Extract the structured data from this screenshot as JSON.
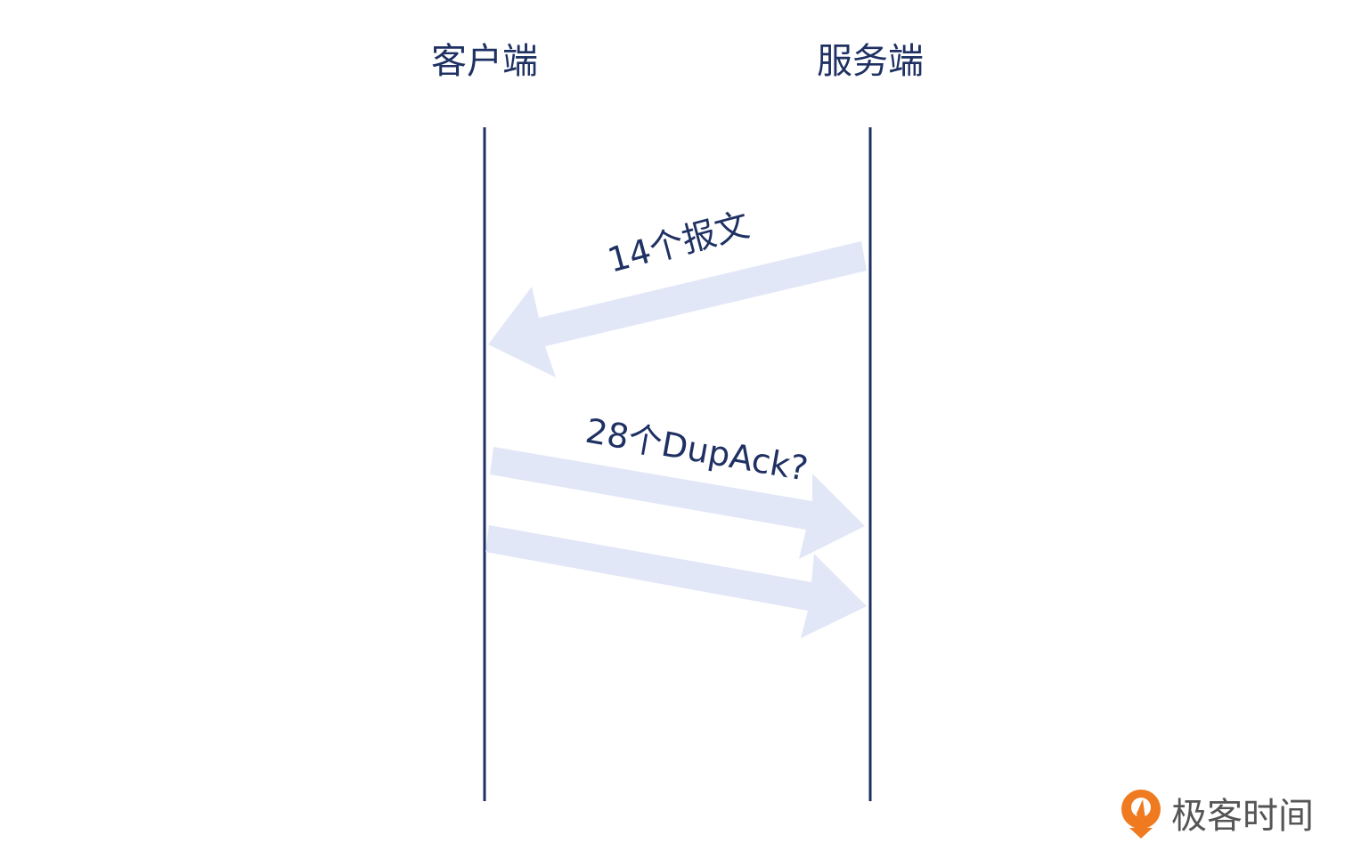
{
  "colors": {
    "line": "#1f3163",
    "arrow": "#e2e7f7",
    "logo_orange": "#ef7a1f",
    "logo_text": "#555555"
  },
  "participants": {
    "client": "客户端",
    "server": "服务端"
  },
  "messages": [
    {
      "label": "14个报文",
      "direction": "server-to-client"
    },
    {
      "label": "28个DupAck?",
      "direction": "client-to-server"
    },
    {
      "label": "",
      "direction": "client-to-server"
    }
  ],
  "logo": {
    "text": "极客时间"
  }
}
